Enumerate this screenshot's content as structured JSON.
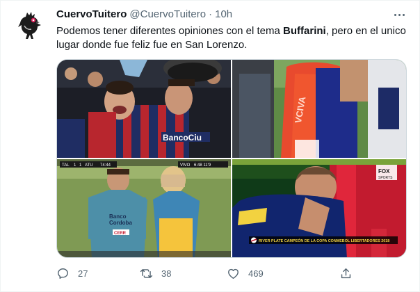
{
  "tweet": {
    "display_name": "CuervoTuitero",
    "handle": "@CuervoTuitero",
    "separator": "·",
    "time": "10h",
    "text_before": "Podemos tener diferentes opiniones con el tema ",
    "text_bold": "Buffarini",
    "text_after": ", pero en el unico lugar donde fue feliz fue en San Lorenzo."
  },
  "media": {
    "photo3_scoreboard": {
      "team_left": "TAL",
      "score_left": "1",
      "team_right": "ATU",
      "score_right": "1",
      "clock": "74:44",
      "logo": "VIVO",
      "extra": "6:48 11'9",
      "shirt_text1": "Banco",
      "shirt_text2": "Cordoba",
      "shirt_text3": "CERR"
    },
    "photo4_banner": {
      "caption": "RIVER PLATE CAMPEÓN DE LA COPA CONMEBOL LIBERTADORES 2018",
      "channel": "FOX",
      "channel_sub": "SPORTS"
    },
    "photo2_shirt_text": "VCIVA",
    "photo1_shirt_text": "BancoCiu"
  },
  "actions": {
    "reply_count": "27",
    "retweet_count": "38",
    "like_count": "469"
  },
  "icons": {
    "avatar": "crow-avatar",
    "more": "more-icon",
    "reply": "reply-icon",
    "retweet": "retweet-icon",
    "like": "heart-icon",
    "share": "share-icon"
  },
  "colors": {
    "text": "#0f1419",
    "secondary": "#536471",
    "border": "#cfd9de"
  }
}
